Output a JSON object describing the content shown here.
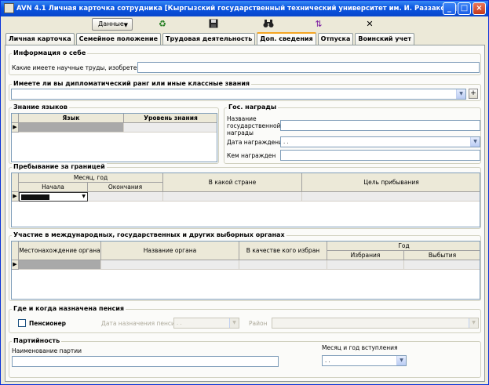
{
  "window": {
    "title": "AVN 4.1 Личная карточка сотрудника [Кыргызский государственный технический университет им. И. Раззакова]"
  },
  "toolbar": {
    "data_button": "Данные"
  },
  "tabs": [
    "Личная карточка",
    "Семейное положение",
    "Трудовая деятельность",
    "Доп. сведения",
    "Отпуска",
    "Воинский учет"
  ],
  "about": {
    "title": "Информация о себе",
    "works_label": "Какие имеете научные труды, изобретения:"
  },
  "rank": {
    "title": "Имеете ли вы дипломатический ранг или иные классные звания"
  },
  "languages": {
    "title": "Знание языков",
    "col_lang": "Язык",
    "col_level": "Уровень знания"
  },
  "awards": {
    "title": "Гос. награды",
    "name_label": "Название государственной награды",
    "date_label": "Дата награждения",
    "date_value": ". .",
    "by_label": "Кем награжден"
  },
  "abroad": {
    "title": "Пребывание за границей",
    "col_month_year": "Месяц, год",
    "col_start": "Начала",
    "col_end": "Окончания",
    "col_country": "В какой стране",
    "col_purpose": "Цель прибывания"
  },
  "bodies": {
    "title": "Участие в международных, государственных и других выборных органах",
    "col_location": "Местонахождение органа",
    "col_name": "Название органа",
    "col_role": "В качестве кого избран",
    "col_year": "Год",
    "col_elected": "Избрания",
    "col_retired": "Выбытия"
  },
  "pension": {
    "title": "Где и когда назначена пенсия",
    "pensioner_label": "Пенсионер",
    "date_label": "Дата назначения пенсии",
    "date_value": ". .",
    "district_label": "Район"
  },
  "party": {
    "title": "Партийность",
    "party_label": "Наименование партии",
    "join_label": "Месяц и год вступления",
    "join_value": ". ."
  }
}
